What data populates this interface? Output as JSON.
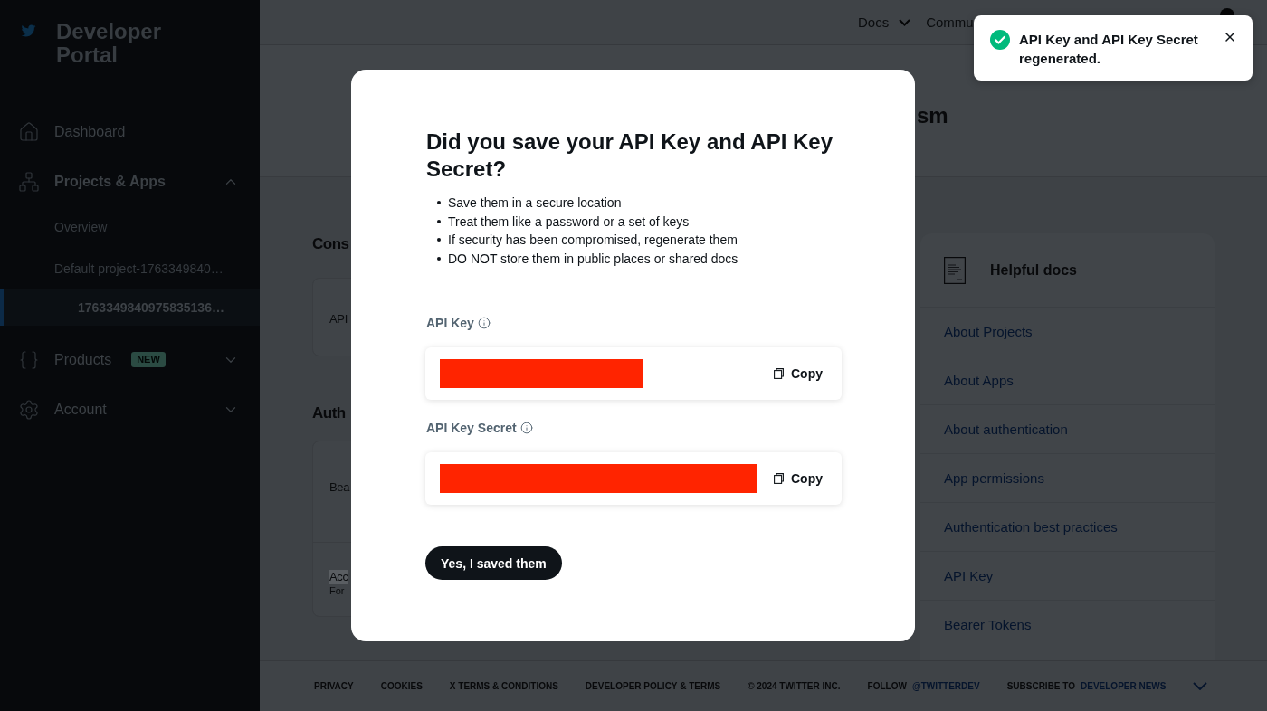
{
  "sidebar": {
    "brand": "Developer Portal",
    "nav": [
      {
        "label": "Dashboard"
      },
      {
        "label": "Projects & Apps",
        "expanded": true,
        "children": [
          {
            "label": "Overview",
            "selected": false
          },
          {
            "label": "Default project-1763349840…",
            "selected": false,
            "children": [
              {
                "label": "1763349840975835136…",
                "selected": true
              }
            ]
          }
        ]
      },
      {
        "label": "Products",
        "badge": "NEW",
        "expanded": false
      },
      {
        "label": "Account",
        "expanded": false
      }
    ]
  },
  "top_nav": [
    {
      "label": "Docs",
      "dropdown": true
    },
    {
      "label": "Commu"
    }
  ],
  "page": {
    "title": "sm",
    "sections": [
      {
        "heading": "Cons",
        "rows": [
          {
            "label": "API",
            "highlighted": false
          }
        ]
      },
      {
        "heading": "Auth",
        "rows": [
          {
            "label": "Bea",
            "highlighted": false
          },
          {
            "label": "Acc",
            "caption": "For",
            "highlighted": true
          }
        ]
      }
    ]
  },
  "helpful_docs": {
    "title": "Helpful docs",
    "links": [
      "About Projects",
      "About Apps",
      "About authentication",
      "App permissions",
      "Authentication best practices",
      "API Key",
      "Bearer Tokens"
    ]
  },
  "footer": {
    "links": [
      "PRIVACY",
      "COOKIES",
      "X TERMS & CONDITIONS",
      "DEVELOPER POLICY & TERMS"
    ],
    "copyright": "© 2024 TWITTER INC.",
    "follow": {
      "label": "FOLLOW",
      "link": "@TWITTERDEV"
    },
    "subscribe": {
      "label": "SUBSCRIBE TO",
      "link": "DEVELOPER NEWS"
    }
  },
  "modal": {
    "title": "Did you save your API Key and API Key Secret?",
    "tips": [
      "Save them in a secure location",
      "Treat them like a password or a set of keys",
      "If security has been compromised, regenerate them",
      "DO NOT store them in public places or shared docs"
    ],
    "fields": [
      {
        "label": "API Key",
        "redacted": true,
        "copy_label": "Copy"
      },
      {
        "label": "API Key Secret",
        "redacted": true,
        "copy_label": "Copy"
      }
    ],
    "confirm_button": "Yes, I saved them"
  },
  "toast": {
    "message": "API Key and API Key Secret regenerated."
  }
}
